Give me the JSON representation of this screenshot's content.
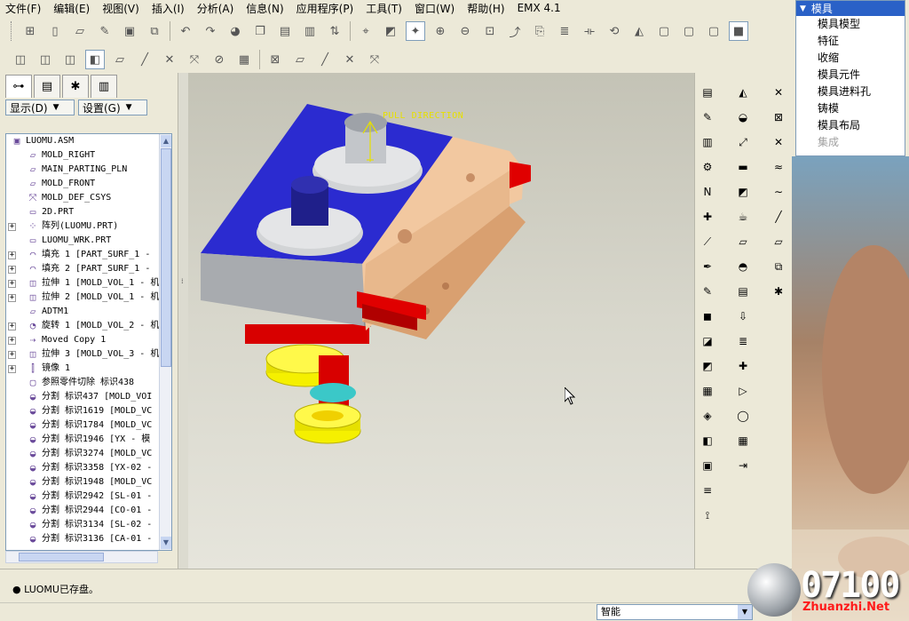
{
  "menubar": {
    "items": [
      "文件(F)",
      "编辑(E)",
      "视图(V)",
      "插入(I)",
      "分析(A)",
      "信息(N)",
      "应用程序(P)",
      "工具(T)",
      "窗口(W)",
      "帮助(H)",
      "EMX 4.1"
    ]
  },
  "left_panel": {
    "display_dropdown": "显示(D)",
    "settings_dropdown": "设置(G)",
    "tree": [
      {
        "label": "LUOMU.ASM",
        "icon": "assembly-icon",
        "indent": 0,
        "expandable": false
      },
      {
        "label": "MOLD_RIGHT",
        "icon": "datum-plane-icon",
        "indent": 1,
        "expandable": false
      },
      {
        "label": "MAIN_PARTING_PLN",
        "icon": "datum-plane-icon",
        "indent": 1,
        "expandable": false
      },
      {
        "label": "MOLD_FRONT",
        "icon": "datum-plane-icon",
        "indent": 1,
        "expandable": false
      },
      {
        "label": "MOLD_DEF_CSYS",
        "icon": "csys-icon",
        "indent": 1,
        "expandable": false
      },
      {
        "label": "2D.PRT",
        "icon": "part-icon",
        "indent": 1,
        "expandable": false
      },
      {
        "label": "阵列(LUOMU.PRT)",
        "icon": "pattern-icon",
        "indent": 1,
        "expandable": true
      },
      {
        "label": "LUOMU_WRK.PRT",
        "icon": "part-icon",
        "indent": 1,
        "expandable": false
      },
      {
        "label": "填充 1 [PART_SURF_1 -",
        "icon": "fill-icon",
        "indent": 1,
        "expandable": true
      },
      {
        "label": "填充 2 [PART_SURF_1 -",
        "icon": "fill-icon",
        "indent": 1,
        "expandable": true
      },
      {
        "label": "拉伸 1 [MOLD_VOL_1 - 机",
        "icon": "extrude-icon",
        "indent": 1,
        "expandable": true
      },
      {
        "label": "拉伸 2 [MOLD_VOL_1 - 机",
        "icon": "extrude-icon",
        "indent": 1,
        "expandable": true
      },
      {
        "label": "ADTM1",
        "icon": "datum-plane-icon",
        "indent": 1,
        "expandable": false
      },
      {
        "label": "旋转 1 [MOLD_VOL_2 - 机",
        "icon": "revolve-icon",
        "indent": 1,
        "expandable": true
      },
      {
        "label": "Moved Copy 1",
        "icon": "move-copy-icon",
        "indent": 1,
        "expandable": true
      },
      {
        "label": "拉伸 3 [MOLD_VOL_3 - 机",
        "icon": "extrude-icon",
        "indent": 1,
        "expandable": true
      },
      {
        "label": "镜像 1",
        "icon": "mirror-icon",
        "indent": 1,
        "expandable": true
      },
      {
        "label": "参照零件切除 标识438",
        "icon": "ref-part-cutout-icon",
        "indent": 1,
        "expandable": false
      },
      {
        "label": "分割 标识437 [MOLD_VOI",
        "icon": "split-icon",
        "indent": 1,
        "expandable": false
      },
      {
        "label": "分割 标识1619 [MOLD_VC",
        "icon": "split-icon",
        "indent": 1,
        "expandable": false
      },
      {
        "label": "分割 标识1784 [MOLD_VC",
        "icon": "split-icon",
        "indent": 1,
        "expandable": false
      },
      {
        "label": "分割 标识1946 [YX - 模",
        "icon": "split-icon",
        "indent": 1,
        "expandable": false
      },
      {
        "label": "分割 标识3274 [MOLD_VC",
        "icon": "split-icon",
        "indent": 1,
        "expandable": false
      },
      {
        "label": "分割 标识3358 [YX-02 -",
        "icon": "split-icon",
        "indent": 1,
        "expandable": false
      },
      {
        "label": "分割 标识1948 [MOLD_VC",
        "icon": "split-icon",
        "indent": 1,
        "expandable": false
      },
      {
        "label": "分割 标识2942 [SL-01 -",
        "icon": "split-icon",
        "indent": 1,
        "expandable": false
      },
      {
        "label": "分割 标识2944 [CO-01 -",
        "icon": "split-icon",
        "indent": 1,
        "expandable": false
      },
      {
        "label": "分割 标识3134 [SL-02 -",
        "icon": "split-icon",
        "indent": 1,
        "expandable": false
      },
      {
        "label": "分割 标识3136 [CA-01 -",
        "icon": "split-icon",
        "indent": 1,
        "expandable": false
      }
    ]
  },
  "viewport": {
    "pull_direction_label": "PULL DIRECTION",
    "colors": {
      "clamp_plate": "#2b2bd0",
      "slide_block": "#f2c8a0",
      "base_plate": "#a8abaf",
      "red_parts": "#e00000",
      "gears": "#f5f000",
      "cores": "#d8dadc"
    }
  },
  "mold_menu": {
    "header": "模具",
    "items": [
      {
        "label": "模具模型",
        "enabled": true
      },
      {
        "label": "特征",
        "enabled": true
      },
      {
        "label": "收缩",
        "enabled": true
      },
      {
        "label": "模具元件",
        "enabled": true
      },
      {
        "label": "模具进料孔",
        "enabled": true
      },
      {
        "label": "铸模",
        "enabled": true
      },
      {
        "label": "模具布局",
        "enabled": true
      },
      {
        "label": "集成",
        "enabled": false
      }
    ]
  },
  "status": {
    "message": "LUOMU已存盘。",
    "filter": "智能"
  },
  "watermark": {
    "number": "07100",
    "site": "Zhuanzhi.Net"
  }
}
